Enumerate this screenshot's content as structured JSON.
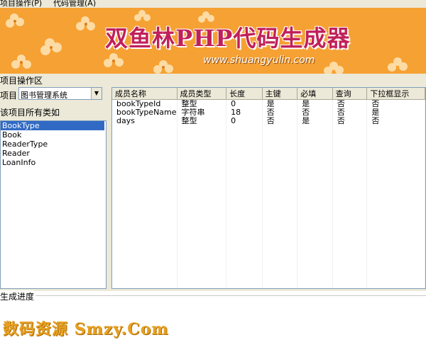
{
  "menu": {
    "items": [
      "项目操作(P)",
      "代码管理(A)"
    ]
  },
  "banner": {
    "title": "双鱼林PHP代码生成器",
    "url": "www.shuangyulin.com",
    "bg_color": "#f6a133",
    "title_color": "#c0205a"
  },
  "workarea": {
    "section_label": "项目操作区",
    "project_label": "项目",
    "project_select": "图书管理系统",
    "classes_label": "该项目所有类如",
    "classes": [
      "BookType",
      "Book",
      "ReaderType",
      "Reader",
      "LoanInfo"
    ],
    "selected_class": "BookType"
  },
  "grid": {
    "columns": [
      "成员名称",
      "成员类型",
      "长度",
      "主键",
      "必填",
      "查询",
      "下拉框显示"
    ],
    "rows": [
      [
        "bookTypeId",
        "整型",
        "0",
        "是",
        "是",
        "否",
        "否"
      ],
      [
        "bookTypeName",
        "字符串",
        "18",
        "否",
        "否",
        "否",
        "是"
      ],
      [
        "days",
        "整型",
        "0",
        "否",
        "是",
        "否",
        "否"
      ]
    ]
  },
  "progress": {
    "label": "生成进度"
  },
  "footer": {
    "watermark": "数码资源 Smzy.Com"
  },
  "colors": {
    "selection": "#316ac5",
    "panel": "#ece9d8"
  }
}
